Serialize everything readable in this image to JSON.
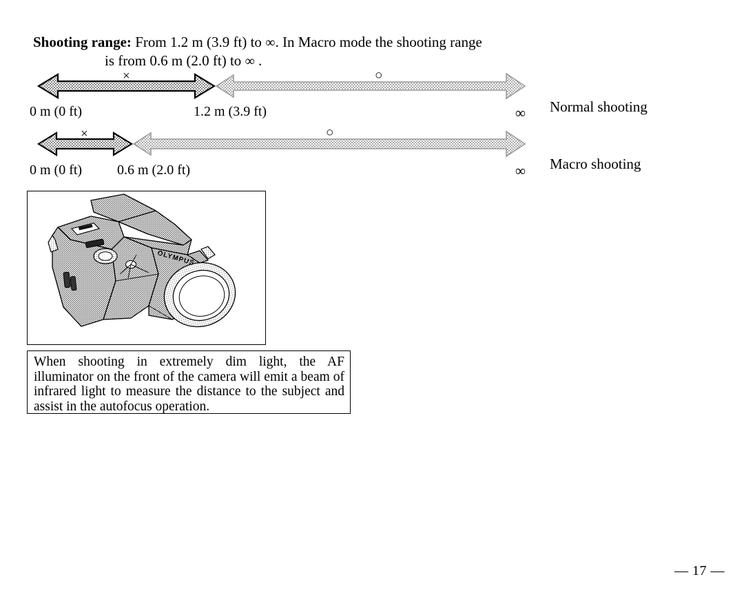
{
  "heading": {
    "label": "Shooting range:",
    "line1": "From 1.2 m (3.9 ft) to",
    "infinity1": "∞",
    "line1_tail": ". In Macro mode the shooting range",
    "line2_lead": "is from 0.6 m (2.0 ft) to",
    "infinity2": "∞",
    "line2_tail": "."
  },
  "diagram": {
    "rows": [
      {
        "name": "normal",
        "label": "Normal shooting",
        "near_mark": "×",
        "far_mark": "○",
        "start_dim": "0 m  (0 ft)",
        "limit_dim": "1.2 m  (3.9 ft)",
        "infinity": "∞"
      },
      {
        "name": "macro",
        "label": "Macro shooting",
        "near_mark": "×",
        "far_mark": "○",
        "start_dim": "0 m (0 ft)",
        "limit_dim": "0.6 m (2.0 ft)",
        "infinity": "∞"
      }
    ]
  },
  "figure": {
    "alt_name": "olympus-camera-illustration",
    "brand_text": "OLYMPUS"
  },
  "caption": {
    "text": "When shooting in extremely dim light, the AF illuminator on the front of the camera will emit a beam of infrared light to measure the distance to the subject and assist in the autofocus operation."
  },
  "footer": {
    "page_number": "— 17 —"
  },
  "colors": {
    "ink": "#000000",
    "paper": "#ffffff",
    "arrow_fill": "#b9b9b9"
  }
}
